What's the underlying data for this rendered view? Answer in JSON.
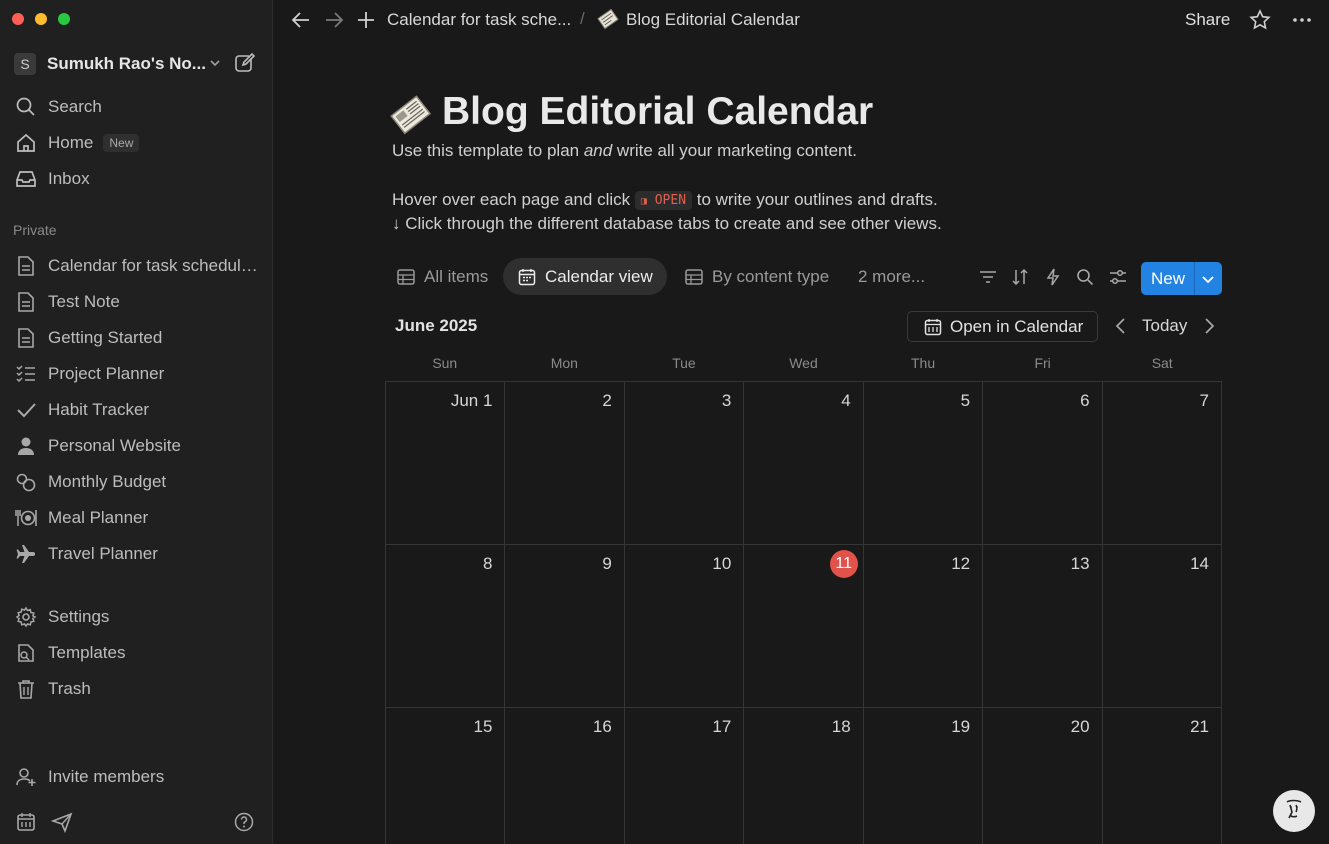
{
  "sidebar": {
    "workspace": {
      "initial": "S",
      "name": "Sumukh Rao's No..."
    },
    "top_items": [
      {
        "label": "Search",
        "icon": "search-icon"
      },
      {
        "label": "Home",
        "icon": "home-icon",
        "badge": "New"
      },
      {
        "label": "Inbox",
        "icon": "inbox-icon"
      }
    ],
    "section_label": "Private",
    "pages": [
      {
        "label": "Calendar for task scheduling",
        "icon": "page-icon"
      },
      {
        "label": "Test Note",
        "icon": "page-icon"
      },
      {
        "label": "Getting Started",
        "icon": "page-icon"
      },
      {
        "label": "Project Planner",
        "icon": "checklist-icon"
      },
      {
        "label": "Habit Tracker",
        "icon": "check-icon"
      },
      {
        "label": "Personal Website",
        "icon": "person-icon"
      },
      {
        "label": "Monthly Budget",
        "icon": "budget-icon"
      },
      {
        "label": "Meal Planner",
        "icon": "meal-icon"
      },
      {
        "label": "Travel Planner",
        "icon": "airplane-icon"
      }
    ],
    "utility_items": [
      {
        "label": "Settings",
        "icon": "gear-icon"
      },
      {
        "label": "Templates",
        "icon": "templates-icon"
      },
      {
        "label": "Trash",
        "icon": "trash-icon"
      }
    ],
    "invite_label": "Invite members"
  },
  "topbar": {
    "breadcrumb_parent": "Calendar for task sche...",
    "breadcrumb_separator": "/",
    "breadcrumb_current": "Blog Editorial Calendar",
    "share_label": "Share"
  },
  "page": {
    "title": "Blog Editorial Calendar",
    "line1_before": "Use this template to plan ",
    "line1_em": "and",
    "line1_after": " write all your marketing content.",
    "line2_before": "Hover over each page and click ",
    "line2_code": "OPEN",
    "line2_after": " to write your outlines and drafts.",
    "line3": "↓ Click through the different database tabs to create and see other views."
  },
  "views": {
    "tabs": [
      {
        "label": "All items",
        "icon": "table-icon",
        "active": false
      },
      {
        "label": "Calendar view",
        "icon": "calendar-icon",
        "active": true
      },
      {
        "label": "By content type",
        "icon": "table-icon",
        "active": false
      }
    ],
    "more_label": "2 more...",
    "new_label": "New"
  },
  "calendar": {
    "month_label": "June 2025",
    "open_in_calendar": "Open in Calendar",
    "today_label": "Today",
    "weekdays": [
      "Sun",
      "Mon",
      "Tue",
      "Wed",
      "Thu",
      "Fri",
      "Sat"
    ],
    "weeks": [
      [
        "Jun 1",
        "2",
        "3",
        "4",
        "5",
        "6",
        "7"
      ],
      [
        "8",
        "9",
        "10",
        "11",
        "12",
        "13",
        "14"
      ],
      [
        "15",
        "16",
        "17",
        "18",
        "19",
        "20",
        "21"
      ]
    ],
    "today": "11",
    "today_color": "#e0524a"
  },
  "colors": {
    "accent": "#2383e2",
    "background": "#191919",
    "sidebar": "#202020"
  }
}
